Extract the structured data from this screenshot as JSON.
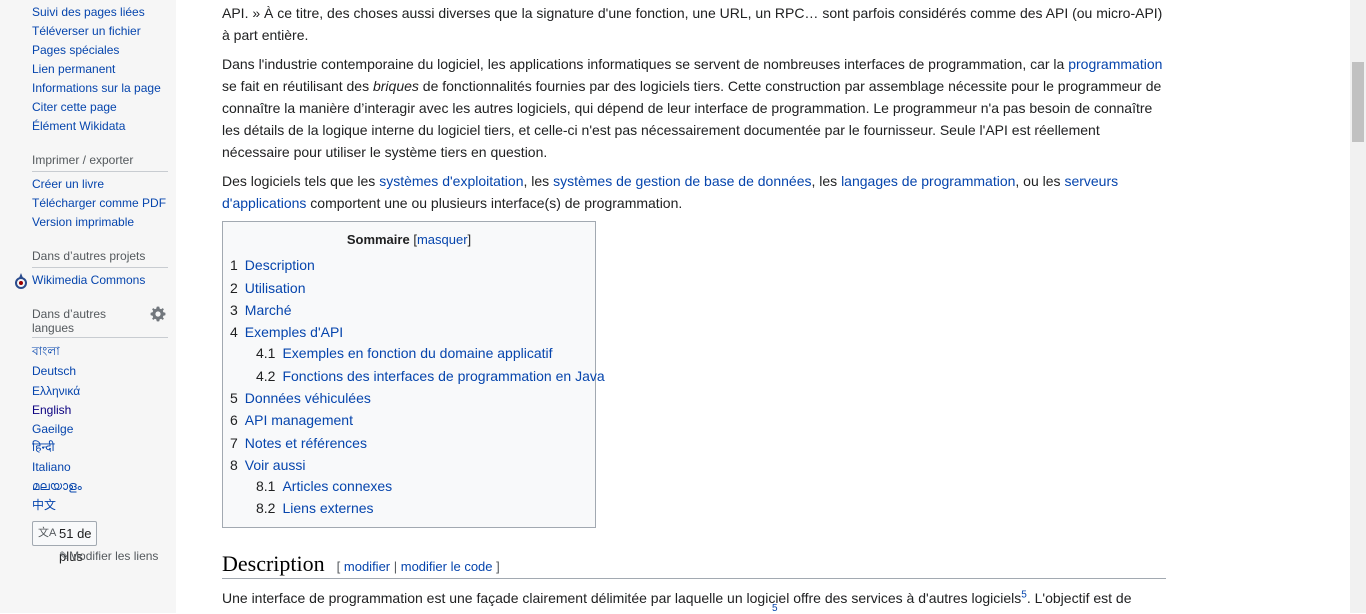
{
  "sidebar": {
    "tools": [
      "Suivi des pages liées",
      "Téléverser un fichier",
      "Pages spéciales",
      "Lien permanent",
      "Informations sur la page",
      "Citer cette page",
      "Élément Wikidata"
    ],
    "print_heading": "Imprimer / exporter",
    "print_items": [
      "Créer un livre",
      "Télécharger comme PDF",
      "Version imprimable"
    ],
    "projects_heading": "Dans d’autres projets",
    "projects_items": [
      "Wikimedia Commons"
    ],
    "languages_heading_1": "Dans d’autres",
    "languages_heading_2": "langues",
    "languages": [
      "বাংলা",
      "Deutsch",
      "Ελληνικά",
      "English",
      "Gaeilge",
      "हिन्दी",
      "Italiano",
      "മലയാളം",
      "中文"
    ],
    "more_languages": "51 de plus",
    "edit_links": "Modifier les liens"
  },
  "content": {
    "p1a": "API. » À ce titre, des choses aussi diverses que la signature d'une fonction, une URL, un RPC… sont parfois considérés comme des API (ou micro-API)",
    "p1b": "à part entière.",
    "p2": {
      "t1": "Dans l'industrie contemporaine du logiciel, les applications informatiques se servent de nombreuses interfaces de programmation, car la ",
      "l1": "programmation",
      "t2": " se fait en réutilisant des ",
      "em": "briques",
      "t3": " de fonctionnalités fournies par des logiciels tiers. Cette construction par assemblage nécessite pour le programmeur de connaître la manière d’interagir avec les autres logiciels, qui dépend de leur interface de programmation. Le programmeur n'a pas besoin de connaître les détails de la logique interne du logiciel tiers, et celle-ci n'est pas nécessairement documentée par le fournisseur. Seule l'API est réellement nécessaire pour utiliser le système tiers en question."
    },
    "p3": {
      "t1": "Des logiciels tels que les ",
      "l1": "systèmes d'exploitation",
      "t2": ", les ",
      "l2": "systèmes de gestion de base de données",
      "t3": ", les ",
      "l3": "langages de programmation",
      "t4": ", ou les ",
      "l4": "serveurs d'applications",
      "t5": " comportent une ou plusieurs interface(s) de programmation."
    },
    "toc": {
      "title": "Sommaire",
      "bracket_open": "[",
      "toggle": "masquer",
      "bracket_close": "]",
      "items": [
        {
          "num": "1",
          "text": "Description"
        },
        {
          "num": "2",
          "text": "Utilisation"
        },
        {
          "num": "3",
          "text": "Marché"
        },
        {
          "num": "4",
          "text": "Exemples d'API"
        },
        {
          "num": "4.1",
          "text": "Exemples en fonction du domaine applicatif"
        },
        {
          "num": "4.2",
          "text": "Fonctions des interfaces de programmation en Java"
        },
        {
          "num": "5",
          "text": "Données véhiculées"
        },
        {
          "num": "6",
          "text": "API management"
        },
        {
          "num": "7",
          "text": "Notes et références"
        },
        {
          "num": "8",
          "text": "Voir aussi"
        },
        {
          "num": "8.1",
          "text": "Articles connexes"
        },
        {
          "num": "8.2",
          "text": "Liens externes"
        }
      ]
    },
    "section": {
      "title": "Description",
      "edit_open": "[ ",
      "edit": "modifier",
      "sep": " | ",
      "edit_code": "modifier le code",
      "edit_close": " ]"
    },
    "p4": {
      "t1": "Une interface de programmation est une façade clairement délimitée par laquelle un logiciel offre des services à d'autres logiciels",
      "ref": "5",
      "t2": ". L'objectif est de",
      "ref2": "5"
    }
  }
}
